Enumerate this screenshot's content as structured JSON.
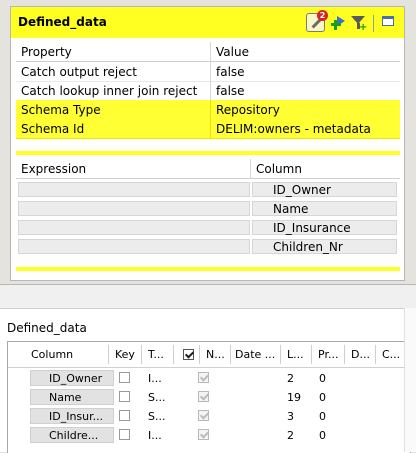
{
  "component": {
    "title": "Defined_data",
    "toolbar": {
      "edit_badge": "2",
      "icons": [
        "edit-schema-icon",
        "add-output-icon",
        "filter-icon",
        "window-icon"
      ]
    },
    "properties": {
      "headers": {
        "property": "Property",
        "value": "Value"
      },
      "rows": [
        {
          "property": "Catch output reject",
          "value": "false",
          "highlighted": false
        },
        {
          "property": "Catch lookup inner join reject",
          "value": "false",
          "highlighted": false
        },
        {
          "property": "Schema Type",
          "value": "Repository",
          "highlighted": true
        },
        {
          "property": "Schema Id",
          "value": "DELIM:owners - metadata",
          "highlighted": true
        }
      ]
    },
    "expressions": {
      "headers": {
        "expression": "Expression",
        "column": "Column"
      },
      "rows": [
        {
          "expression": "",
          "column": "ID_Owner"
        },
        {
          "expression": "",
          "column": "Name"
        },
        {
          "expression": "",
          "column": "ID_Insurance"
        },
        {
          "expression": "",
          "column": "Children_Nr"
        }
      ]
    }
  },
  "schema_panel": {
    "title": "Defined_data",
    "headers": [
      "Column",
      "Key",
      "T...",
      "N...",
      "Date ...",
      "L...",
      "Pr...",
      "D...",
      "C..."
    ],
    "rows": [
      {
        "column": "ID_Owner",
        "key": false,
        "type": "I...",
        "nullable": true,
        "length": "2",
        "precision": "0"
      },
      {
        "column": "Name",
        "key": false,
        "type": "S...",
        "nullable": true,
        "length": "19",
        "precision": "0"
      },
      {
        "column": "ID_Insur...",
        "key": false,
        "type": "S...",
        "nullable": true,
        "length": "3",
        "precision": "0"
      },
      {
        "column": "Childre...",
        "key": false,
        "type": "I...",
        "nullable": true,
        "length": "2",
        "precision": "0"
      }
    ]
  },
  "colors": {
    "highlight": "#ffff33",
    "header_yellow": "#ffff21"
  }
}
